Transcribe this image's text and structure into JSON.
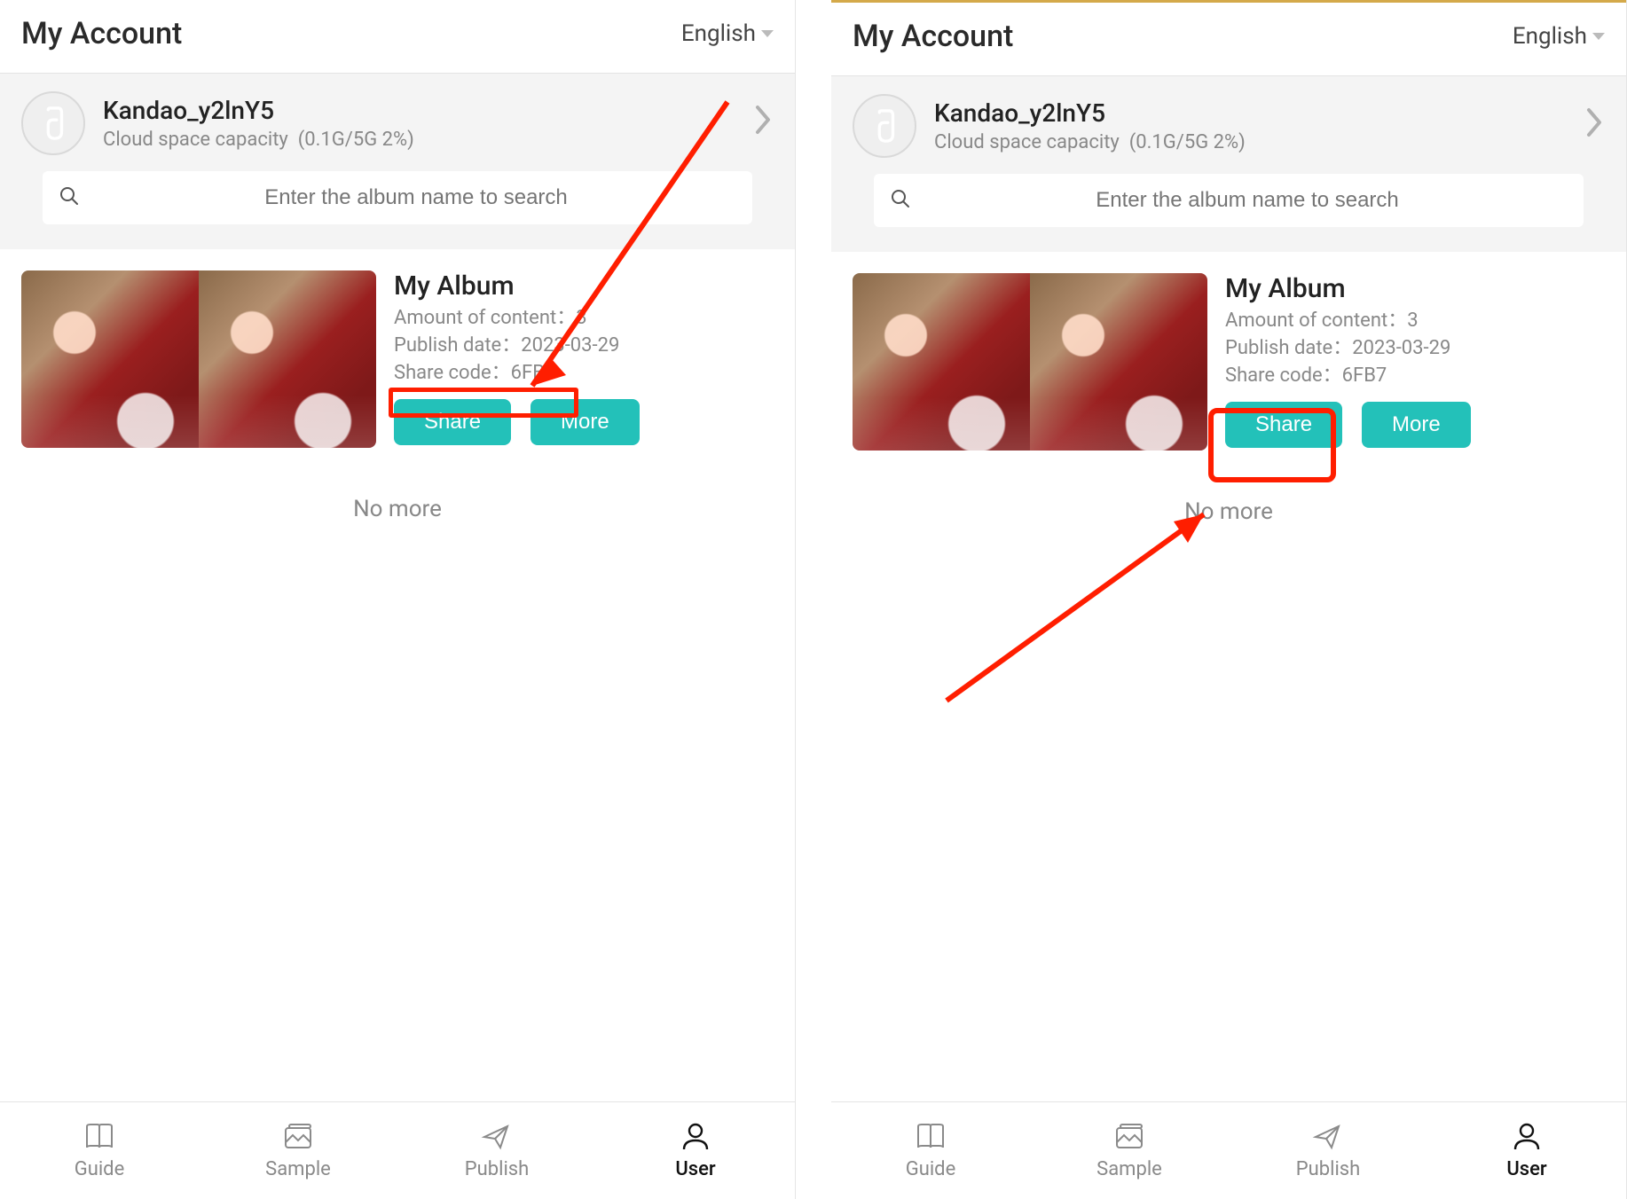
{
  "header": {
    "title": "My Account",
    "language": "English"
  },
  "account": {
    "username": "Kandao_y2lnY5",
    "cloud_label": "Cloud space capacity",
    "cloud_value": "(0.1G/5G 2%)"
  },
  "search": {
    "placeholder": "Enter the album name to search"
  },
  "album": {
    "title": "My Album",
    "amount_label": "Amount of content：",
    "amount_value": "3",
    "publish_label": "Publish date：",
    "publish_value": "2023-03-29",
    "code_label": "Share code：",
    "code_value": "6FB7",
    "share_btn": "Share",
    "more_btn": "More"
  },
  "list": {
    "no_more": "No more"
  },
  "tabs": {
    "guide": "Guide",
    "sample": "Sample",
    "publish": "Publish",
    "user": "User"
  }
}
